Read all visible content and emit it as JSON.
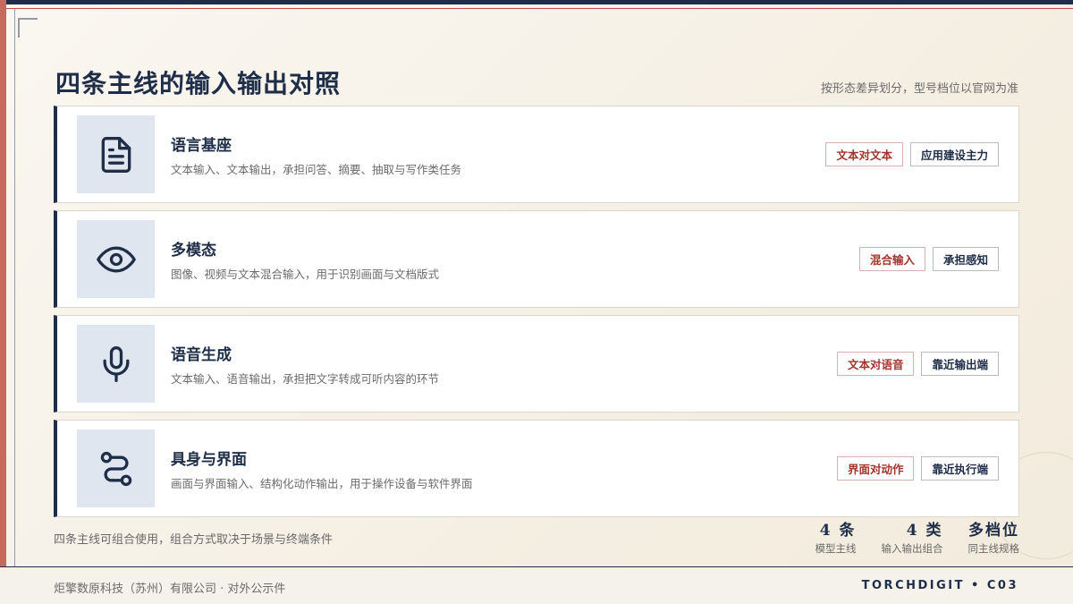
{
  "header": {
    "title": "四条主线的输入输出对照",
    "subtitle": "按形态差异划分，型号档位以官网为准"
  },
  "rows": [
    {
      "icon": "document-icon",
      "title": "语言基座",
      "desc": "文本输入、文本输出，承担问答、摘要、抽取与写作类任务",
      "tag1": "文本对文本",
      "tag2": "应用建设主力"
    },
    {
      "icon": "eye-icon",
      "title": "多模态",
      "desc": "图像、视频与文本混合输入，用于识别画面与文档版式",
      "tag1": "混合输入",
      "tag2": "承担感知"
    },
    {
      "icon": "microphone-icon",
      "title": "语音生成",
      "desc": "文本输入、语音输出，承担把文字转成可听内容的环节",
      "tag1": "文本对语音",
      "tag2": "靠近输出端"
    },
    {
      "icon": "route-icon",
      "title": "具身与界面",
      "desc": "画面与界面输入、结构化动作输出，用于操作设备与软件界面",
      "tag1": "界面对动作",
      "tag2": "靠近执行端"
    }
  ],
  "footer": {
    "note": "四条主线可组合使用，组合方式取决于场景与终端条件",
    "stats": [
      {
        "value": "4 条",
        "label": "模型主线"
      },
      {
        "value": "4 类",
        "label": "输入输出组合"
      },
      {
        "value": "多档位",
        "label": "同主线规格"
      }
    ],
    "company": "炬擎数原科技（苏州）有限公司 · 对外公示件",
    "code": "TORCHDIGIT • C03"
  },
  "colors": {
    "navy": "#1f2e48",
    "accent_red": "#a3352c",
    "icon_bg": "#e0e6ef"
  }
}
